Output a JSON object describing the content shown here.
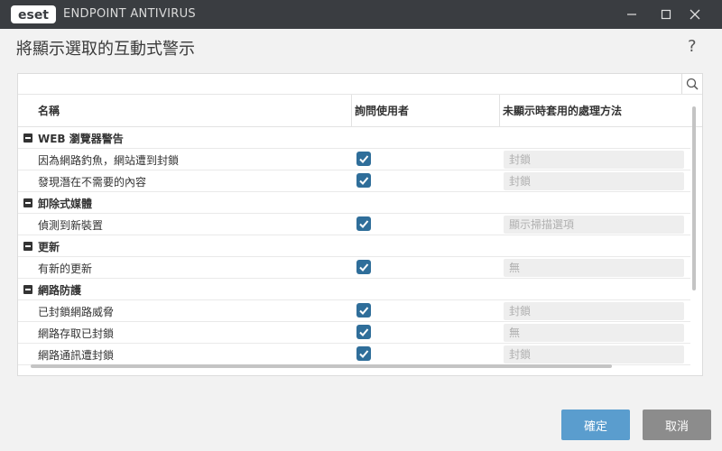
{
  "window": {
    "logo_text": "eset",
    "app_name": "ENDPOINT ANTIVIRUS",
    "title_bar_color": "#3a3d41"
  },
  "dialog": {
    "title": "將顯示選取的互動式警示",
    "help": "?"
  },
  "table": {
    "columns": [
      "名稱",
      "詢問使用者",
      "未顯示時套用的處理方法"
    ],
    "groups": [
      {
        "label": "WEB 瀏覽器警告",
        "items": [
          {
            "label": "因為網路釣魚，網站遭到封鎖",
            "checked": true,
            "action": "封鎖"
          },
          {
            "label": "發現潛在不需要的內容",
            "checked": true,
            "action": "封鎖"
          }
        ]
      },
      {
        "label": "卸除式媒體",
        "items": [
          {
            "label": "偵測到新裝置",
            "checked": true,
            "action": "顯示掃描選項"
          }
        ]
      },
      {
        "label": "更新",
        "items": [
          {
            "label": "有新的更新",
            "checked": true,
            "action": "無"
          }
        ]
      },
      {
        "label": "網路防護",
        "items": [
          {
            "label": "已封鎖網路威脅",
            "checked": true,
            "action": "封鎖"
          },
          {
            "label": "網路存取已封鎖",
            "checked": true,
            "action": "無"
          },
          {
            "label": "網路通訊遭封鎖",
            "checked": true,
            "action": "封鎖"
          }
        ]
      }
    ]
  },
  "buttons": {
    "ok": "確定",
    "cancel": "取消"
  },
  "colors": {
    "ok": "#5a9dce",
    "cancel": "#8c8c8c",
    "checkbox": "#2f6e9a"
  }
}
